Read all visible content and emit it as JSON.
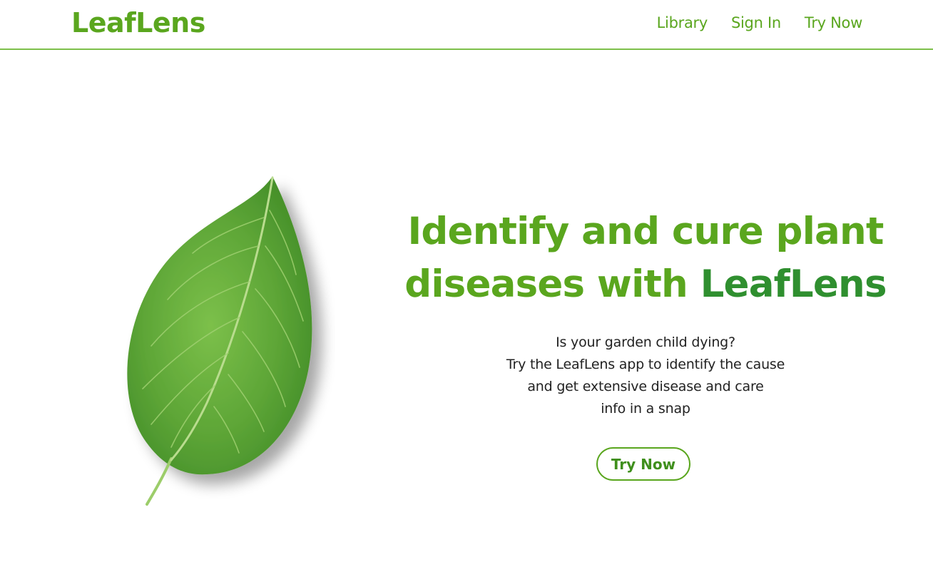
{
  "header": {
    "logo": "LeafLens",
    "nav": [
      {
        "label": "Library"
      },
      {
        "label": "Sign In"
      },
      {
        "label": "Try Now"
      }
    ]
  },
  "hero": {
    "title_part1": "Identify and cure plant diseases with ",
    "title_brand": "LeafLens",
    "description_lines": [
      "Is your garden child dying?",
      "Try the LeafLens app to identify the cause",
      "and get extensive disease and care",
      "info in a snap"
    ],
    "cta_label": "Try Now"
  },
  "colors": {
    "accent": "#5aa61e",
    "brand_dark": "#2f8f2f",
    "divider": "#7dbf4a"
  }
}
